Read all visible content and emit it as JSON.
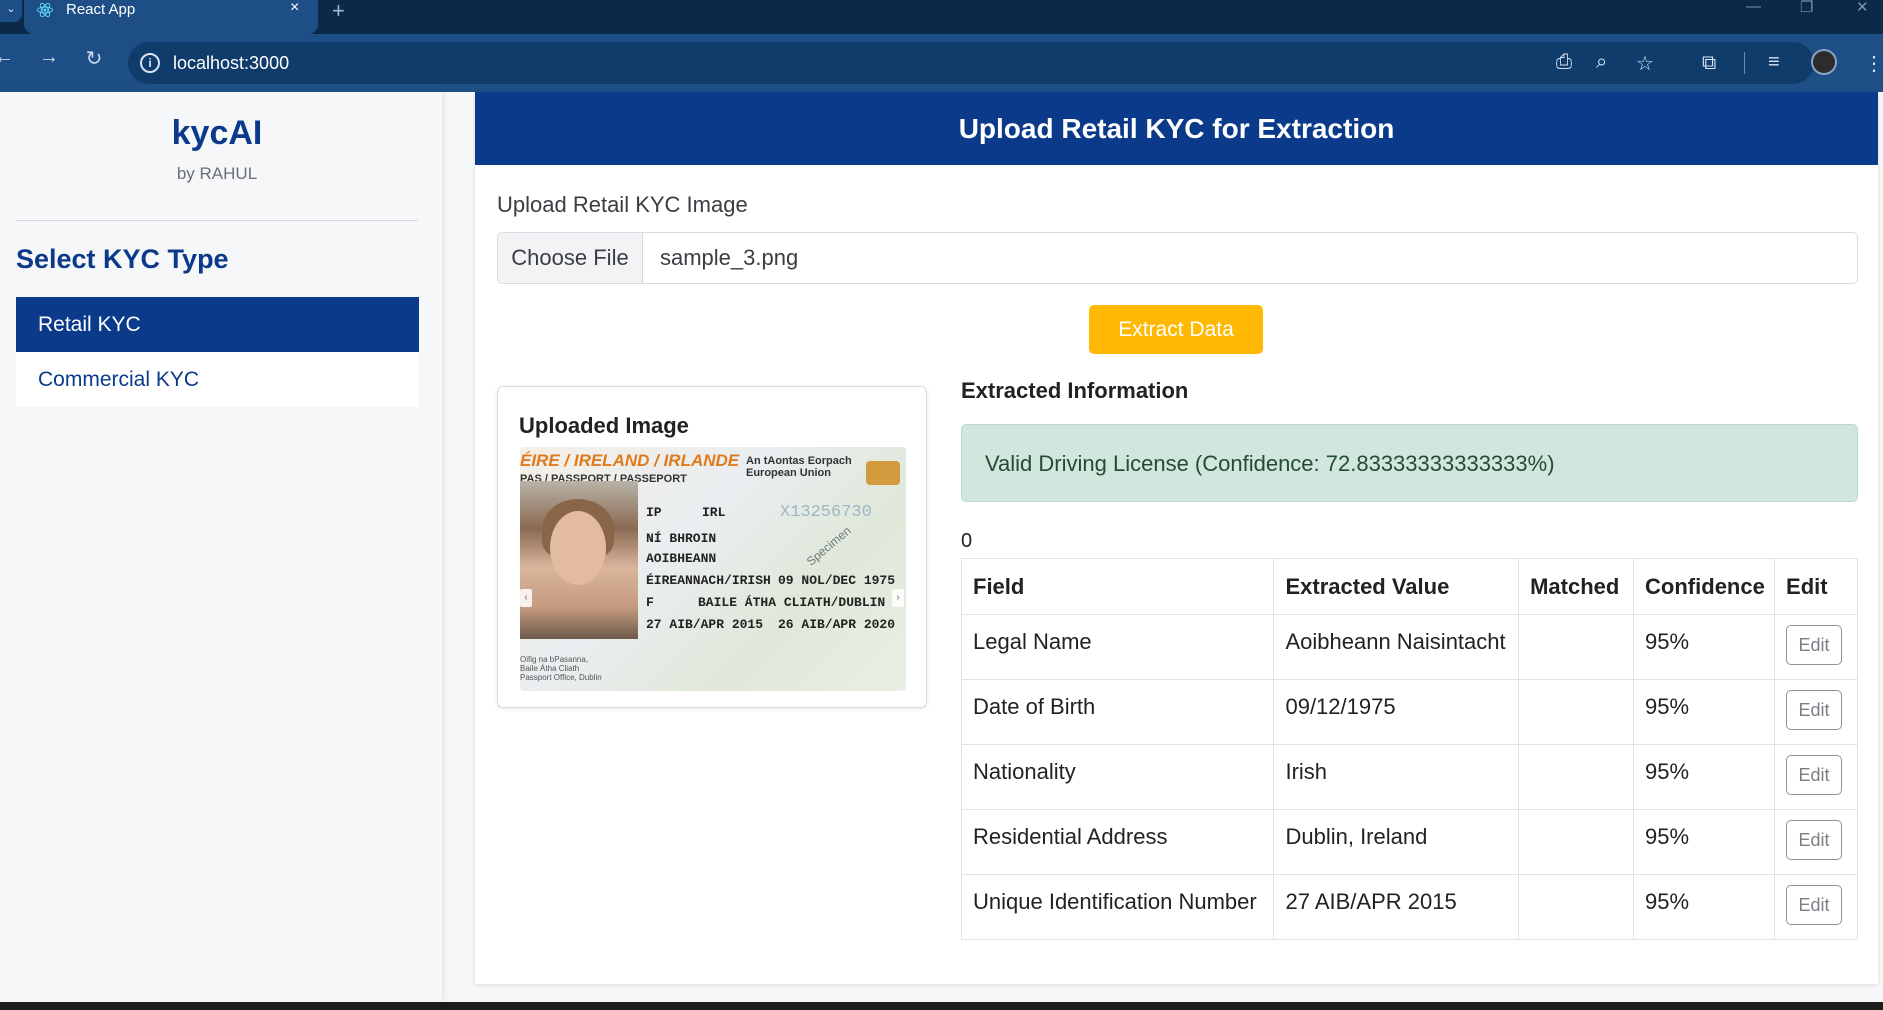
{
  "browser": {
    "tab_title": "React App",
    "tab_close": "×",
    "new_tab": "+",
    "url": "localhost:3000",
    "window_controls": [
      "—",
      "❐",
      "✕"
    ]
  },
  "sidebar": {
    "brand": "kycAI",
    "brand_sub": "by RAHUL",
    "heading": "Select KYC Type",
    "items": [
      {
        "label": "Retail KYC",
        "active": true
      },
      {
        "label": "Commercial KYC",
        "active": false
      }
    ]
  },
  "main": {
    "header": "Upload Retail KYC for Extraction",
    "upload_label": "Upload Retail KYC Image",
    "choose_file_label": "Choose File",
    "file_name": "sample_3.png",
    "extract_button": "Extract Data",
    "uploaded_image_title": "Uploaded Image",
    "passport": {
      "banner": "ÉIRE / IRELAND / IRLANDE",
      "banner2": "PAS / PASSPORT / PASSEPORT",
      "eu": "An tAontas Eorpach\nEuropean Union",
      "type": "IP",
      "country": "IRL",
      "number": "X13256730",
      "surname": "NÍ BHROIN",
      "given": "AOIBHEANN",
      "nationality": "ÉIREANNACH/IRISH",
      "dob": "09 NOL/DEC 1975",
      "sex": "F",
      "place": "BAILE ÁTHA CLIATH/DUBLIN",
      "issue": "27 AIB/APR 2015",
      "expiry": "26 AIB/APR 2020",
      "specimen": "Specimen",
      "authority": "Oifig na bPasanna,\nBaile Átha Cliath\nPassport Office, Dublin"
    },
    "extracted_title": "Extracted Information",
    "alert_text": "Valid Driving License (Confidence: 72.83333333333333%)",
    "count_text": "0",
    "table": {
      "headers": [
        "Field",
        "Extracted Value",
        "Matched",
        "Confidence",
        "Edit"
      ],
      "rows": [
        {
          "field": "Legal Name",
          "value": "Aoibheann Naisintacht",
          "matched": "",
          "confidence": "95%",
          "edit": "Edit"
        },
        {
          "field": "Date of Birth",
          "value": "09/12/1975",
          "matched": "",
          "confidence": "95%",
          "edit": "Edit"
        },
        {
          "field": "Nationality",
          "value": "Irish",
          "matched": "",
          "confidence": "95%",
          "edit": "Edit"
        },
        {
          "field": "Residential Address",
          "value": "Dublin, Ireland",
          "matched": "",
          "confidence": "95%",
          "edit": "Edit"
        },
        {
          "field": "Unique Identification Number",
          "value": "27 AIB/APR 2015",
          "matched": "",
          "confidence": "95%",
          "edit": "Edit"
        }
      ]
    }
  },
  "colors": {
    "brand_blue": "#0b3a8a",
    "accent_yellow": "#ffb804",
    "success_bg": "#d1e7dd",
    "chrome_tab": "#1d4f86",
    "chrome_bg": "#0b2a4a"
  }
}
